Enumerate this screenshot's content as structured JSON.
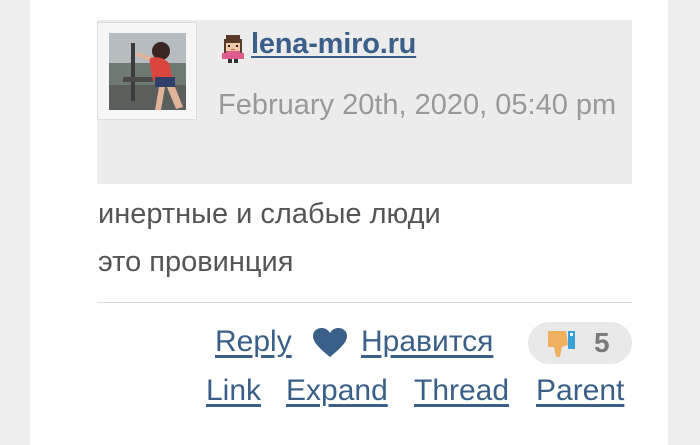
{
  "comment": {
    "username": "lena-miro.ru",
    "timestamp": "February 20th, 2020, 05:40 pm",
    "body_lines": [
      "инертные и слабые люди",
      "это провинция"
    ]
  },
  "actions": {
    "reply": "Reply",
    "like": "Нравится",
    "dislike_count": "5",
    "link": "Link",
    "expand": "Expand",
    "thread": "Thread",
    "parent": "Parent"
  },
  "icons": {
    "user": "user-pixel-icon",
    "like": "heart-icon",
    "dislike": "thumbs-down-icon"
  },
  "colors": {
    "link": "#3a5f88",
    "header_bg": "#ececec",
    "timestamp": "#999999",
    "text": "#555555",
    "thumb_orange": "#f0b060",
    "thumb_cuff": "#3aa0d8"
  }
}
